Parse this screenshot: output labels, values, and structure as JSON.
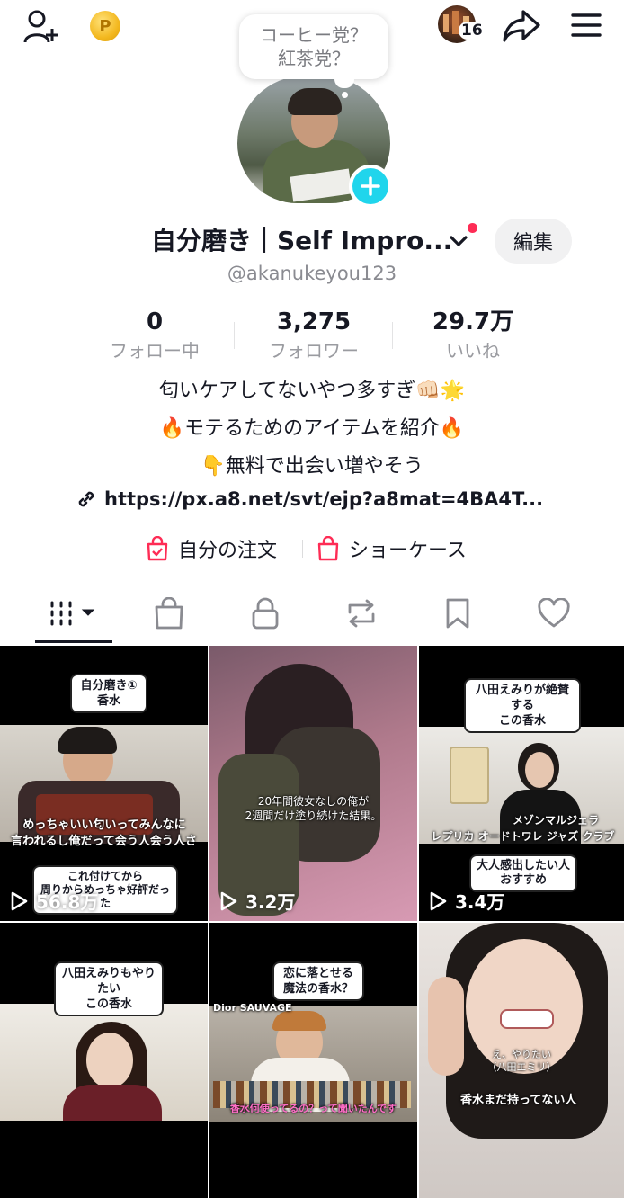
{
  "header": {
    "coin_label": "P",
    "notification_count": "16"
  },
  "profile": {
    "bubble_line1": "コーヒー党？",
    "bubble_line2": "紅茶党？",
    "display_name": "自分磨き｜Self Impro...",
    "edit_label": "編集",
    "handle": "@akanukeyou123"
  },
  "stats": [
    {
      "value": "0",
      "label": "フォロー中"
    },
    {
      "value": "3,275",
      "label": "フォロワー"
    },
    {
      "value": "29.7万",
      "label": "いいね"
    }
  ],
  "bio": {
    "line1": "匂いケアしてないやつ多すぎ👊🏻🌟",
    "line2": "🔥モテるためのアイテムを紹介🔥",
    "line3": "👇無料で出会い増やそう",
    "link": "https://px.a8.net/svt/ejp?a8mat=4BA4T..."
  },
  "shop": {
    "orders_label": "自分の注文",
    "showcase_label": "ショーケース"
  },
  "tabs": [
    "videos",
    "shop",
    "private",
    "reposts",
    "saved",
    "liked"
  ],
  "accent_colors": {
    "plus": "#20d5ec",
    "dot": "#fe2c55",
    "shop_icon": "#fe2c55"
  },
  "videos": [
    {
      "caption": "自分磨き①\n香水",
      "overlay1": "めっちゃいい匂いってみんなに",
      "overlay2": "言われるし俺だって会う人会う人さ",
      "sub_caption": "これ付けてから\n周りからめっちゃ好評だった",
      "views": "56.8万"
    },
    {
      "overlay1": "20年間彼女なしの俺が",
      "overlay2": "2週間だけ塗り続けた結果。",
      "views": "3.2万"
    },
    {
      "caption": "八田えみりが絶賛する\nこの香水",
      "overlay1": "メゾンマルジェラ",
      "overlay2": "レプリカ オードトワレ ジャズ クラブ",
      "sub_caption": "大人感出したい人\nおすすめ",
      "views": "3.4万"
    },
    {
      "caption": "八田えみりもやりたい\nこの香水"
    },
    {
      "caption": "恋に落とせる\n魔法の香水？",
      "overlay1": "Dior SAUVAGE",
      "overlay2": "香水何使ってるの？って聞いたんです"
    },
    {
      "overlay1": "え、やりたい",
      "overlay2": "（八田エミリ）",
      "overlay3": "香水まだ持ってない人"
    }
  ]
}
